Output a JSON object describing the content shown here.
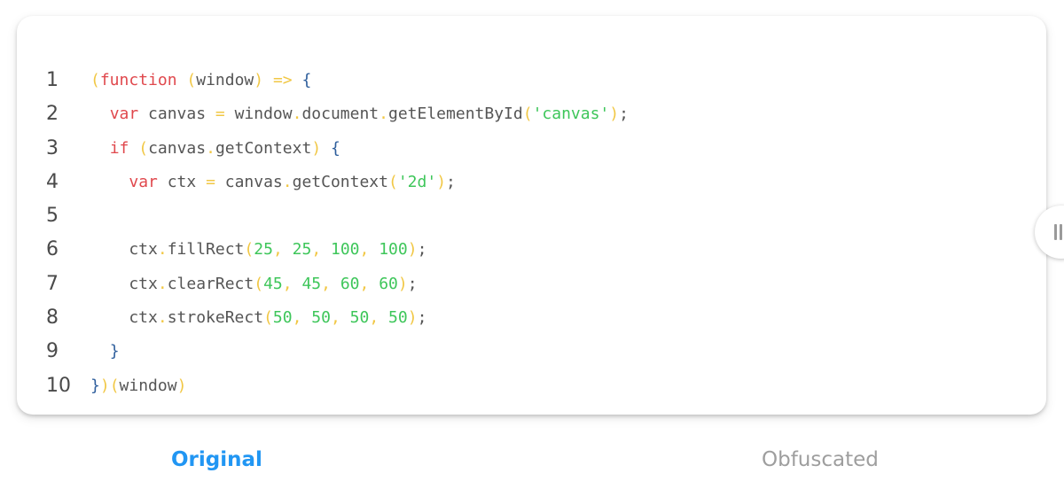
{
  "colors": {
    "keyword": "#e0484d",
    "punctuation": "#f1c744",
    "brace": "#2e5e9c",
    "string_number": "#3ec65a",
    "identifier": "#555555",
    "active_tab": "#2196f3",
    "inactive_tab": "#9e9e9e"
  },
  "code": {
    "lines": [
      {
        "number": "1",
        "tokens": [
          {
            "t": "(",
            "k": "pn"
          },
          {
            "t": "function",
            "k": "kw"
          },
          {
            "t": " ",
            "k": "id"
          },
          {
            "t": "(",
            "k": "pn"
          },
          {
            "t": "window",
            "k": "id"
          },
          {
            "t": ")",
            "k": "pn"
          },
          {
            "t": " ",
            "k": "id"
          },
          {
            "t": "=>",
            "k": "pn"
          },
          {
            "t": " ",
            "k": "id"
          },
          {
            "t": "{",
            "k": "br"
          }
        ]
      },
      {
        "number": "2",
        "tokens": [
          {
            "t": "  ",
            "k": "id"
          },
          {
            "t": "var",
            "k": "kw"
          },
          {
            "t": " canvas ",
            "k": "id"
          },
          {
            "t": "=",
            "k": "pn"
          },
          {
            "t": " window",
            "k": "id"
          },
          {
            "t": ".",
            "k": "pn"
          },
          {
            "t": "document",
            "k": "id"
          },
          {
            "t": ".",
            "k": "pn"
          },
          {
            "t": "getElementById",
            "k": "id"
          },
          {
            "t": "(",
            "k": "pn"
          },
          {
            "t": "'canvas'",
            "k": "str"
          },
          {
            "t": ")",
            "k": "pn"
          },
          {
            "t": ";",
            "k": "id"
          }
        ]
      },
      {
        "number": "3",
        "tokens": [
          {
            "t": "  ",
            "k": "id"
          },
          {
            "t": "if",
            "k": "kw"
          },
          {
            "t": " ",
            "k": "id"
          },
          {
            "t": "(",
            "k": "pn"
          },
          {
            "t": "canvas",
            "k": "id"
          },
          {
            "t": ".",
            "k": "pn"
          },
          {
            "t": "getContext",
            "k": "id"
          },
          {
            "t": ")",
            "k": "pn"
          },
          {
            "t": " ",
            "k": "id"
          },
          {
            "t": "{",
            "k": "br"
          }
        ]
      },
      {
        "number": "4",
        "tokens": [
          {
            "t": "    ",
            "k": "id"
          },
          {
            "t": "var",
            "k": "kw"
          },
          {
            "t": " ctx ",
            "k": "id"
          },
          {
            "t": "=",
            "k": "pn"
          },
          {
            "t": " canvas",
            "k": "id"
          },
          {
            "t": ".",
            "k": "pn"
          },
          {
            "t": "getContext",
            "k": "id"
          },
          {
            "t": "(",
            "k": "pn"
          },
          {
            "t": "'2d'",
            "k": "str"
          },
          {
            "t": ")",
            "k": "pn"
          },
          {
            "t": ";",
            "k": "id"
          }
        ]
      },
      {
        "number": "5",
        "tokens": []
      },
      {
        "number": "6",
        "tokens": [
          {
            "t": "    ctx",
            "k": "id"
          },
          {
            "t": ".",
            "k": "pn"
          },
          {
            "t": "fillRect",
            "k": "id"
          },
          {
            "t": "(",
            "k": "pn"
          },
          {
            "t": "25",
            "k": "num"
          },
          {
            "t": ", ",
            "k": "pn"
          },
          {
            "t": "25",
            "k": "num"
          },
          {
            "t": ", ",
            "k": "pn"
          },
          {
            "t": "100",
            "k": "num"
          },
          {
            "t": ", ",
            "k": "pn"
          },
          {
            "t": "100",
            "k": "num"
          },
          {
            "t": ")",
            "k": "pn"
          },
          {
            "t": ";",
            "k": "id"
          }
        ]
      },
      {
        "number": "7",
        "tokens": [
          {
            "t": "    ctx",
            "k": "id"
          },
          {
            "t": ".",
            "k": "pn"
          },
          {
            "t": "clearRect",
            "k": "id"
          },
          {
            "t": "(",
            "k": "pn"
          },
          {
            "t": "45",
            "k": "num"
          },
          {
            "t": ", ",
            "k": "pn"
          },
          {
            "t": "45",
            "k": "num"
          },
          {
            "t": ", ",
            "k": "pn"
          },
          {
            "t": "60",
            "k": "num"
          },
          {
            "t": ", ",
            "k": "pn"
          },
          {
            "t": "60",
            "k": "num"
          },
          {
            "t": ")",
            "k": "pn"
          },
          {
            "t": ";",
            "k": "id"
          }
        ]
      },
      {
        "number": "8",
        "tokens": [
          {
            "t": "    ctx",
            "k": "id"
          },
          {
            "t": ".",
            "k": "pn"
          },
          {
            "t": "strokeRect",
            "k": "id"
          },
          {
            "t": "(",
            "k": "pn"
          },
          {
            "t": "50",
            "k": "num"
          },
          {
            "t": ", ",
            "k": "pn"
          },
          {
            "t": "50",
            "k": "num"
          },
          {
            "t": ", ",
            "k": "pn"
          },
          {
            "t": "50",
            "k": "num"
          },
          {
            "t": ", ",
            "k": "pn"
          },
          {
            "t": "50",
            "k": "num"
          },
          {
            "t": ")",
            "k": "pn"
          },
          {
            "t": ";",
            "k": "id"
          }
        ]
      },
      {
        "number": "9",
        "tokens": [
          {
            "t": "  ",
            "k": "id"
          },
          {
            "t": "}",
            "k": "br"
          }
        ]
      },
      {
        "number": "10",
        "tokens": [
          {
            "t": "}",
            "k": "br"
          },
          {
            "t": ")",
            "k": "pn"
          },
          {
            "t": "(",
            "k": "pn"
          },
          {
            "t": "window",
            "k": "id"
          },
          {
            "t": ")",
            "k": "pn"
          }
        ]
      }
    ]
  },
  "scroll_handle": {
    "icon": "pause-bars-icon"
  },
  "tabs": {
    "original": "Original",
    "obfuscated": "Obfuscated",
    "active": "original"
  }
}
